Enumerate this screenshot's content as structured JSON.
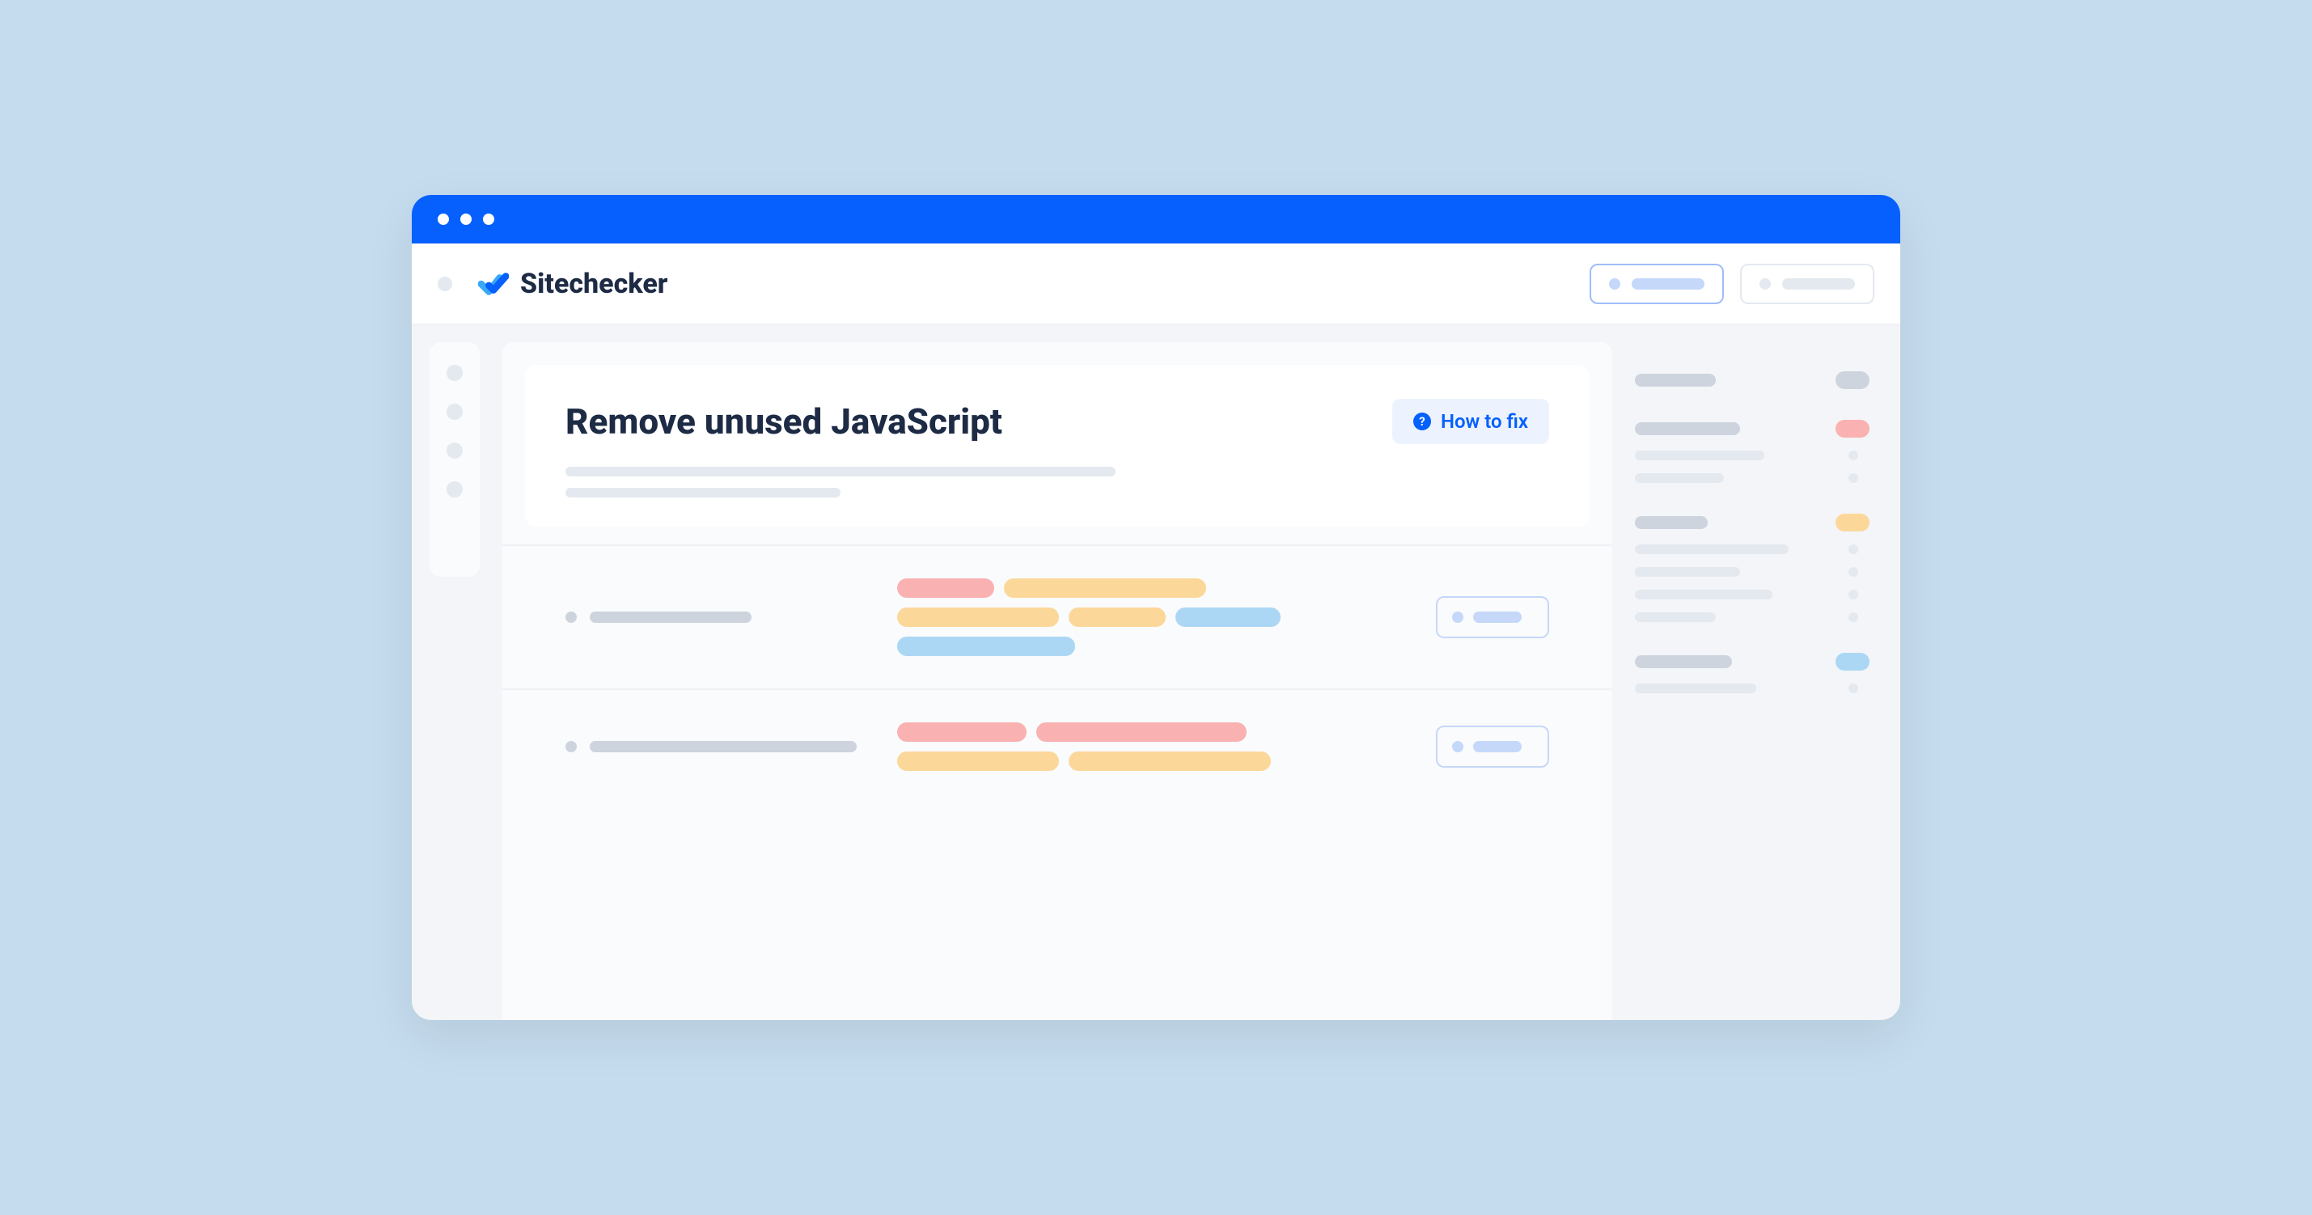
{
  "brand": "Sitechecker",
  "card": {
    "title": "Remove unused JavaScript",
    "howto_label": "How to fix"
  },
  "colors": {
    "accent": "#0560fd",
    "page_bg": "#c5dcee",
    "red": "#fab1b1",
    "orange": "#fcd79a",
    "blue": "#abd7f5",
    "gray": "#cdd4de"
  }
}
